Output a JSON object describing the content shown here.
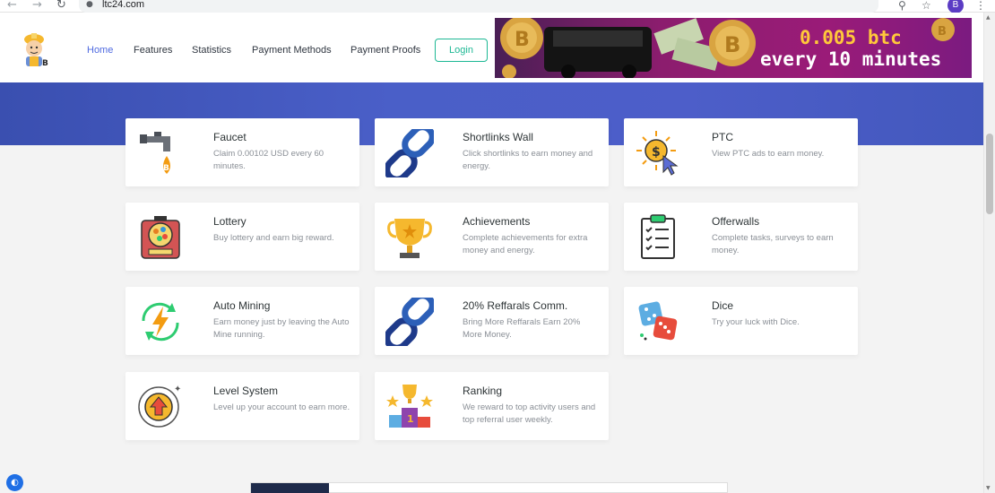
{
  "browser": {
    "back": "←",
    "forward": "→",
    "reload": "↻",
    "lock": "🔒",
    "url": "ltc24.com",
    "avatar_letter": "B",
    "menu": "⋮"
  },
  "nav": {
    "items": [
      "Home",
      "Features",
      "Statistics",
      "Payment Methods",
      "Payment Proofs"
    ],
    "login_label": "Login"
  },
  "ad": {
    "line1": "0.005 btc",
    "line2": "every 10 minutes"
  },
  "cards": [
    {
      "title": "Faucet",
      "desc": "Claim 0.00102 USD every 60 minutes.",
      "icon": "faucet-icon"
    },
    {
      "title": "Shortlinks Wall",
      "desc": "Click shortlinks to earn money and energy.",
      "icon": "chain-link-icon"
    },
    {
      "title": "PTC",
      "desc": "View PTC ads to earn money.",
      "icon": "coin-cursor-icon"
    },
    {
      "title": "Lottery",
      "desc": "Buy lottery and earn big reward.",
      "icon": "lottery-machine-icon"
    },
    {
      "title": "Achievements",
      "desc": "Complete achievements for extra money and energy.",
      "icon": "trophy-icon"
    },
    {
      "title": "Offerwalls",
      "desc": "Complete tasks, surveys to earn money.",
      "icon": "clipboard-checklist-icon"
    },
    {
      "title": "Auto Mining",
      "desc": "Earn money just by leaving the Auto Mine running.",
      "icon": "lightning-refresh-icon"
    },
    {
      "title": "20% Reffarals Comm.",
      "desc": "Bring More Reffarals Earn 20% More Money.",
      "icon": "chain-link-icon"
    },
    {
      "title": "Dice",
      "desc": "Try your luck with Dice.",
      "icon": "dice-icon"
    },
    {
      "title": "Level System",
      "desc": "Level up your account to earn more.",
      "icon": "level-up-icon"
    },
    {
      "title": "Ranking",
      "desc": "We reward to top activity users and top referral user weekly.",
      "icon": "podium-icon"
    }
  ],
  "colors": {
    "accent": "#4f6ae0",
    "login_green": "#1db894",
    "hero": "#4a5fc8"
  }
}
